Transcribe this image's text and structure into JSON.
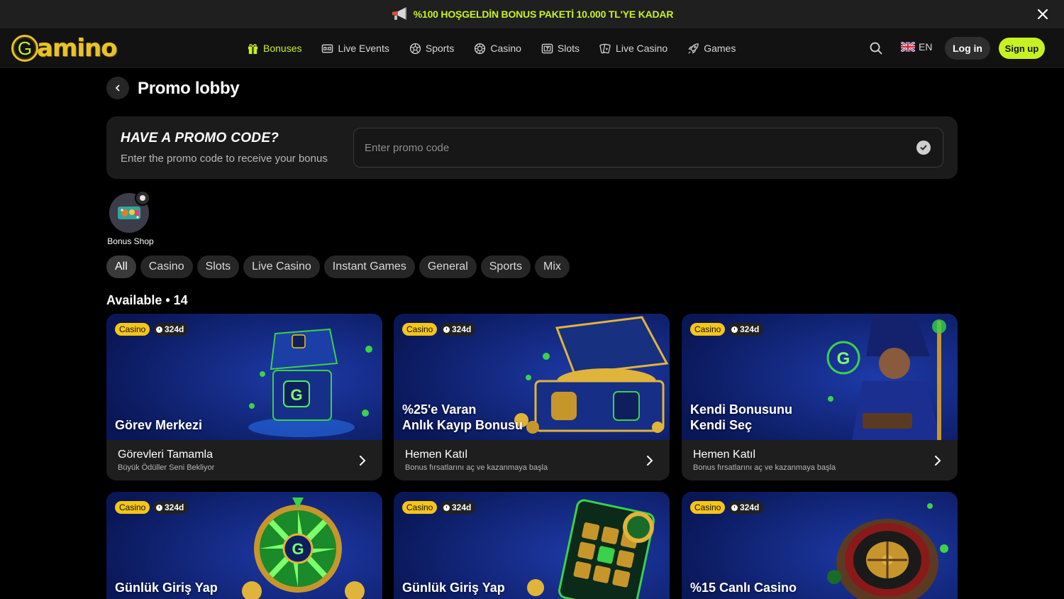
{
  "banner": {
    "text": "%100 HOŞGELDİN BONUS PAKETİ 10.000 TL'YE KADAR"
  },
  "header": {
    "logo_text": "amino",
    "logo_letter": "G",
    "nav": [
      {
        "label": "Bonuses",
        "icon": "gift-icon",
        "active": true
      },
      {
        "label": "Live Events",
        "icon": "scoreboard-icon"
      },
      {
        "label": "Sports",
        "icon": "soccer-ball-icon"
      },
      {
        "label": "Casino",
        "icon": "casino-chip-icon"
      },
      {
        "label": "Slots",
        "icon": "slot-machine-icon"
      },
      {
        "label": "Live Casino",
        "icon": "cards-icon"
      },
      {
        "label": "Games",
        "icon": "rocket-icon"
      }
    ],
    "language": "EN",
    "login_label": "Log in",
    "signup_label": "Sign up"
  },
  "page": {
    "title": "Promo lobby",
    "promo": {
      "heading": "HAVE A PROMO CODE?",
      "subtext": "Enter the promo code to receive your bonus",
      "placeholder": "Enter promo code"
    },
    "bonus_shop_label": "Bonus Shop",
    "filters": [
      "All",
      "Casino",
      "Slots",
      "Live Casino",
      "Instant Games",
      "General",
      "Sports",
      "Mix"
    ],
    "available_label": "Available • 14"
  },
  "cards": [
    {
      "badge": "Casino",
      "time": "324d",
      "title_lines": [
        "Görev Merkezi"
      ],
      "foot_title": "Görevleri Tamamla",
      "foot_sub": "Büyük Ödüller Seni Bekliyor",
      "art": "chest-icon"
    },
    {
      "badge": "Casino",
      "time": "324d",
      "title_lines": [
        "%25'e Varan",
        "Anlık Kayıp Bonusu"
      ],
      "foot_title": "Hemen Katıl",
      "foot_sub": "Bonus fırsatlarını aç ve kazanmaya başla",
      "art": "treasure-chest-icon"
    },
    {
      "badge": "Casino",
      "time": "324d",
      "title_lines": [
        "Kendi Bonusunu",
        "Kendi Seç"
      ],
      "foot_title": "Hemen Katıl",
      "foot_sub": "Bonus fırsatlarını aç ve kazanmaya başla",
      "art": "wizard-icon"
    },
    {
      "badge": "Casino",
      "time": "324d",
      "title_lines": [
        "Günlük Giriş Yap",
        ""
      ],
      "foot_title": "",
      "foot_sub": "",
      "art": "wheel-icon"
    },
    {
      "badge": "Casino",
      "time": "324d",
      "title_lines": [
        "Günlük Giriş Yap",
        ""
      ],
      "foot_title": "",
      "foot_sub": "",
      "art": "scratch-card-icon"
    },
    {
      "badge": "Casino",
      "time": "324d",
      "title_lines": [
        "%15 Canlı Casino",
        ""
      ],
      "foot_title": "",
      "foot_sub": "",
      "art": "roulette-icon"
    }
  ],
  "colors": {
    "accent": "#c6f221",
    "badge": "#f5c518",
    "card_bg": "#1e1e1e",
    "card_art_bg": "#0b1e6b"
  }
}
